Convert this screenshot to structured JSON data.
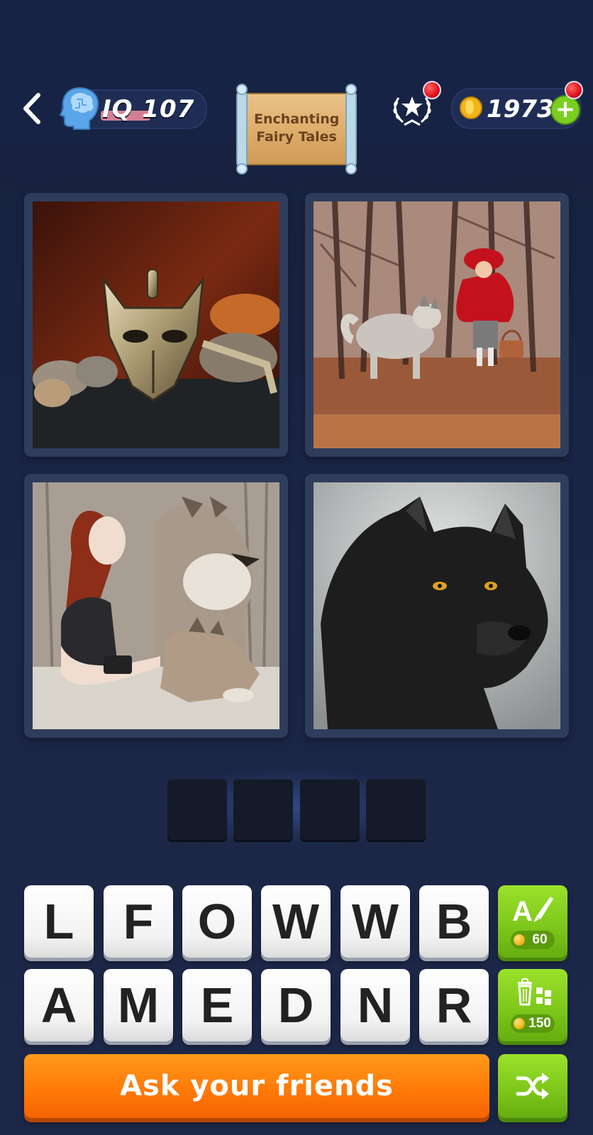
{
  "header": {
    "iq_label": "IQ 107",
    "category_title_line1": "Enchanting",
    "category_title_line2": "Fairy Tales",
    "coins": "1973",
    "plus_label": "+"
  },
  "tiles": [
    {
      "name": "wolf-pendant-photo"
    },
    {
      "name": "red-riding-hood-photo"
    },
    {
      "name": "woman-with-wolves-photo"
    },
    {
      "name": "black-wolf-photo"
    }
  ],
  "answer": {
    "length": 4,
    "slots": [
      "",
      "",
      "",
      ""
    ]
  },
  "letters": {
    "row1": [
      "L",
      "F",
      "O",
      "W",
      "W",
      "B"
    ],
    "row2": [
      "A",
      "M",
      "E",
      "D",
      "N",
      "R"
    ]
  },
  "hints": {
    "reveal_letter_cost": "60",
    "remove_letters_cost": "150"
  },
  "ask_friends_label": "Ask your friends",
  "colors": {
    "accent_green": "#7ccd22",
    "ask_orange": "#ff7a08",
    "background": "#1a2545",
    "notification_red": "#e0101a"
  }
}
